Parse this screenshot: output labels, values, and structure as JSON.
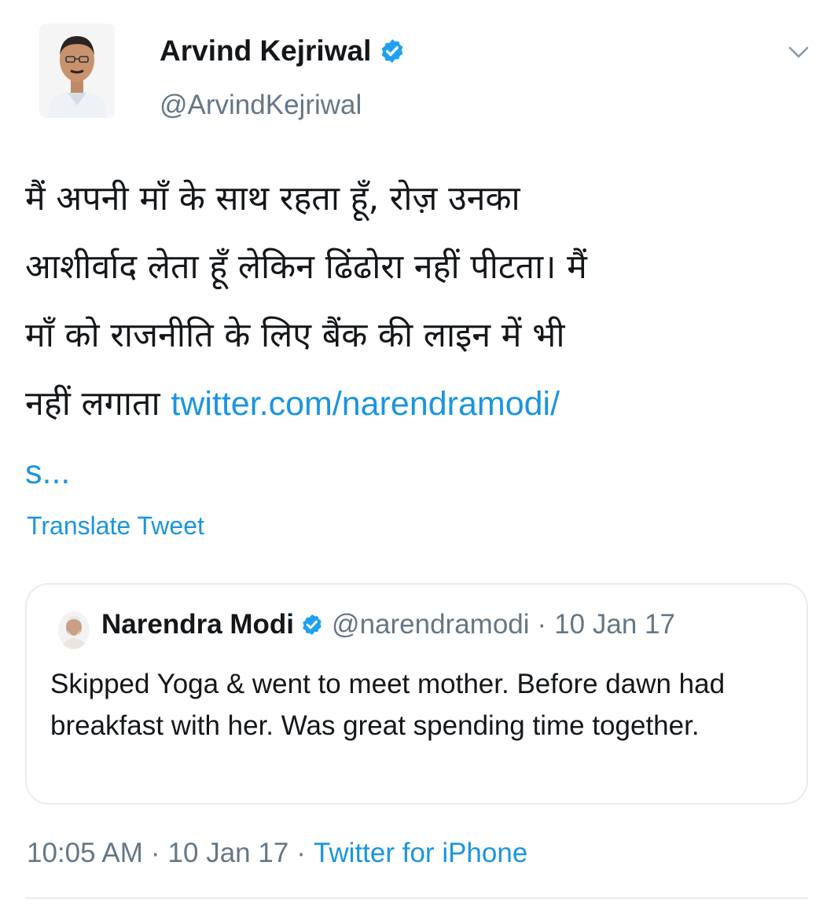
{
  "tweet": {
    "author_name": "Arvind Kejriwal",
    "author_handle": "@ArvindKejriwal",
    "text_lines": [
      "मैं अपनी माँ के साथ रहता हूँ, रोज़ उनका",
      "आशीर्वाद लेता हूँ लेकिन ढिंढोरा नहीं पीटता। मैं",
      "माँ को राजनीति के लिए बैंक की लाइन में भी",
      "नहीं लगाता "
    ],
    "link_part1": "twitter.com/narendramodi/",
    "link_part2": "s...",
    "translate_label": "Translate Tweet",
    "avatar_icon": "person-avatar-icon",
    "menu_icon": "chevron-down-icon"
  },
  "quoted": {
    "author_name": "Narendra Modi",
    "author_handle": "@narendramodi",
    "separator": "·",
    "date": "10 Jan 17",
    "text": "Skipped Yoga & went to meet mother. Before dawn had breakfast with her. Was great spending time together."
  },
  "footer": {
    "time": "10:05 AM",
    "separator": "·",
    "date": "10 Jan 17",
    "source": "Twitter for iPhone"
  },
  "colors": {
    "link": "#1b95e0",
    "verified": "#1da1f2",
    "muted": "#657786",
    "border": "#e6ecf0"
  }
}
